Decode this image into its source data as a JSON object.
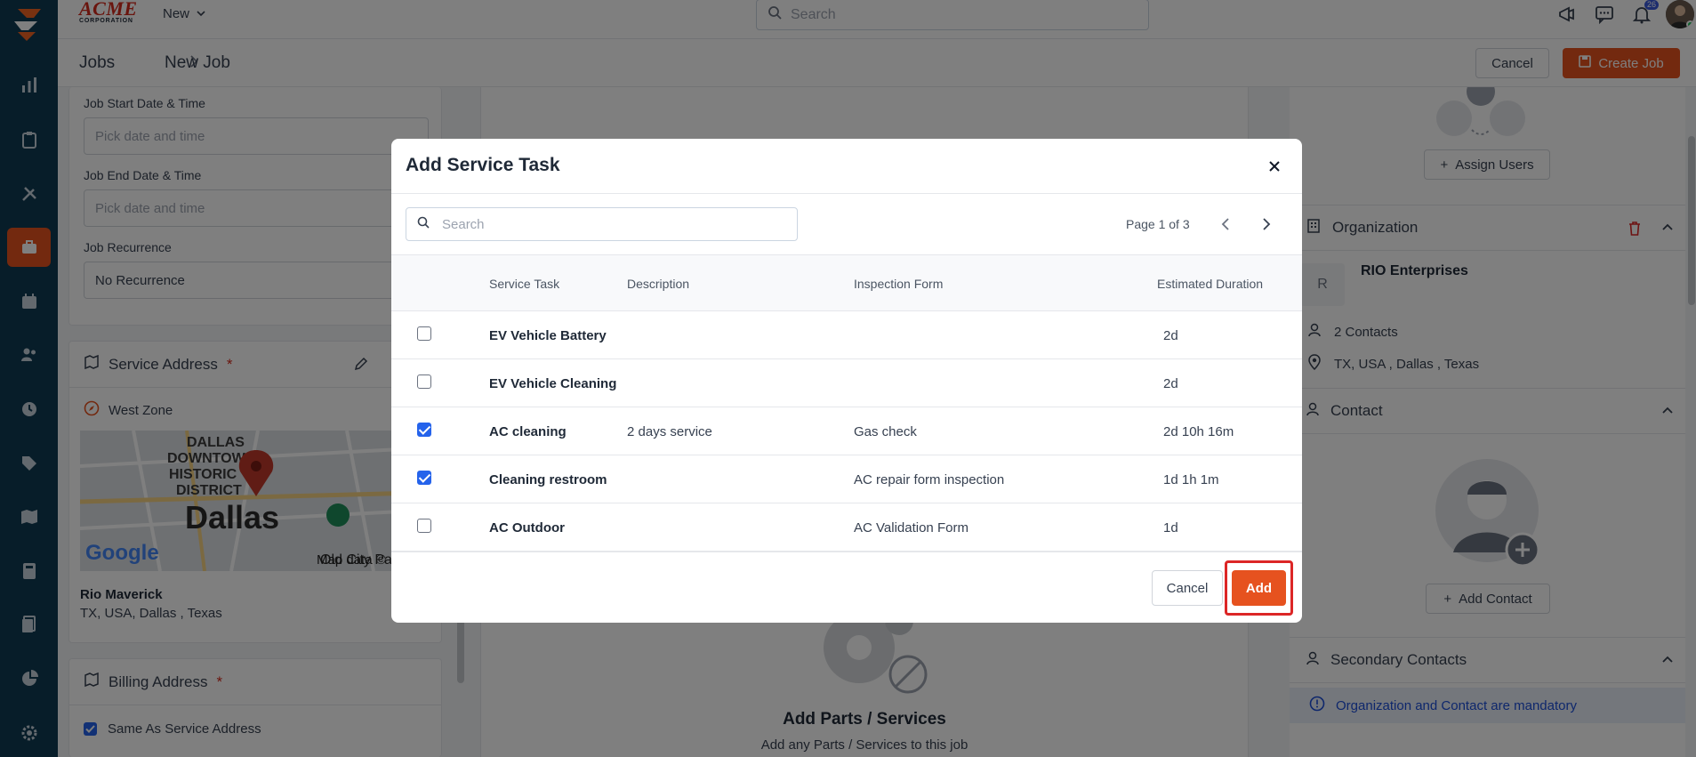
{
  "brand": {
    "name": "ACME",
    "sub": "CORPORATION"
  },
  "topbar": {
    "new_label": "New",
    "search_placeholder": "Search",
    "notification_count": "26"
  },
  "breadcrumb": {
    "root": "Jobs",
    "current": "New Job"
  },
  "actions": {
    "cancel": "Cancel",
    "create": "Create Job"
  },
  "sidebar": {
    "items": [
      "logo-icon",
      "dashboard-icon",
      "clipboard-icon",
      "tools-icon",
      "briefcase-icon",
      "calendar-icon",
      "users-icon",
      "clock-icon",
      "tag-icon",
      "map-icon",
      "calculator-icon",
      "documents-icon",
      "pie-chart-icon",
      "gear-icon"
    ],
    "active": "briefcase-icon",
    "accent": "#e6521f"
  },
  "left": {
    "start_label": "Job Start Date & Time",
    "start_placeholder": "Pick date and time",
    "end_label": "Job End Date & Time",
    "end_placeholder": "Pick date and time",
    "recurrence_label": "Job Recurrence",
    "recurrence_value": "No Recurrence",
    "service_address_title": "Service Address",
    "required_mark": "*",
    "zone": "West Zone",
    "map_city": "Dallas",
    "map_district": "DALLAS DOWNTOWN HISTORIC DISTRICT",
    "map_credit": "Map data ©",
    "map_provider": "Google",
    "contact_name": "Rio Maverick",
    "contact_address": "TX, USA, Dallas , Texas",
    "billing_title": "Billing Address",
    "same_as_service": "Same As Service Address"
  },
  "center": {
    "title": "Add Parts / Services",
    "subtitle": "Add any Parts / Services to this job"
  },
  "right": {
    "assign_users": "Assign Users",
    "organization_title": "Organization",
    "org_initial": "R",
    "org_name": "RIO Enterprises",
    "contacts_count": "2 Contacts",
    "org_address": "TX, USA , Dallas , Texas",
    "contact_title": "Contact",
    "add_contact": "Add Contact",
    "secondary_title": "Secondary Contacts",
    "notice": "Organization and Contact are mandatory"
  },
  "modal": {
    "title": "Add Service Task",
    "search_placeholder": "Search",
    "pager": "Page 1 of 3",
    "columns": {
      "task": "Service Task",
      "description": "Description",
      "form": "Inspection Form",
      "duration": "Estimated Duration"
    },
    "rows": [
      {
        "task": "EV Vehicle Battery",
        "description": "",
        "form": "",
        "duration": "2d",
        "checked": false
      },
      {
        "task": "EV Vehicle Cleaning",
        "description": "",
        "form": "",
        "duration": "2d",
        "checked": false
      },
      {
        "task": "AC cleaning",
        "description": "2 days service",
        "form": "Gas check",
        "duration": "2d 10h 16m",
        "checked": true
      },
      {
        "task": "Cleaning restroom",
        "description": "",
        "form": "AC repair form inspection",
        "duration": "1d 1h 1m",
        "checked": true
      },
      {
        "task": "AC Outdoor",
        "description": "",
        "form": "AC Validation Form",
        "duration": "1d",
        "checked": false
      }
    ],
    "cancel": "Cancel",
    "add": "Add"
  }
}
